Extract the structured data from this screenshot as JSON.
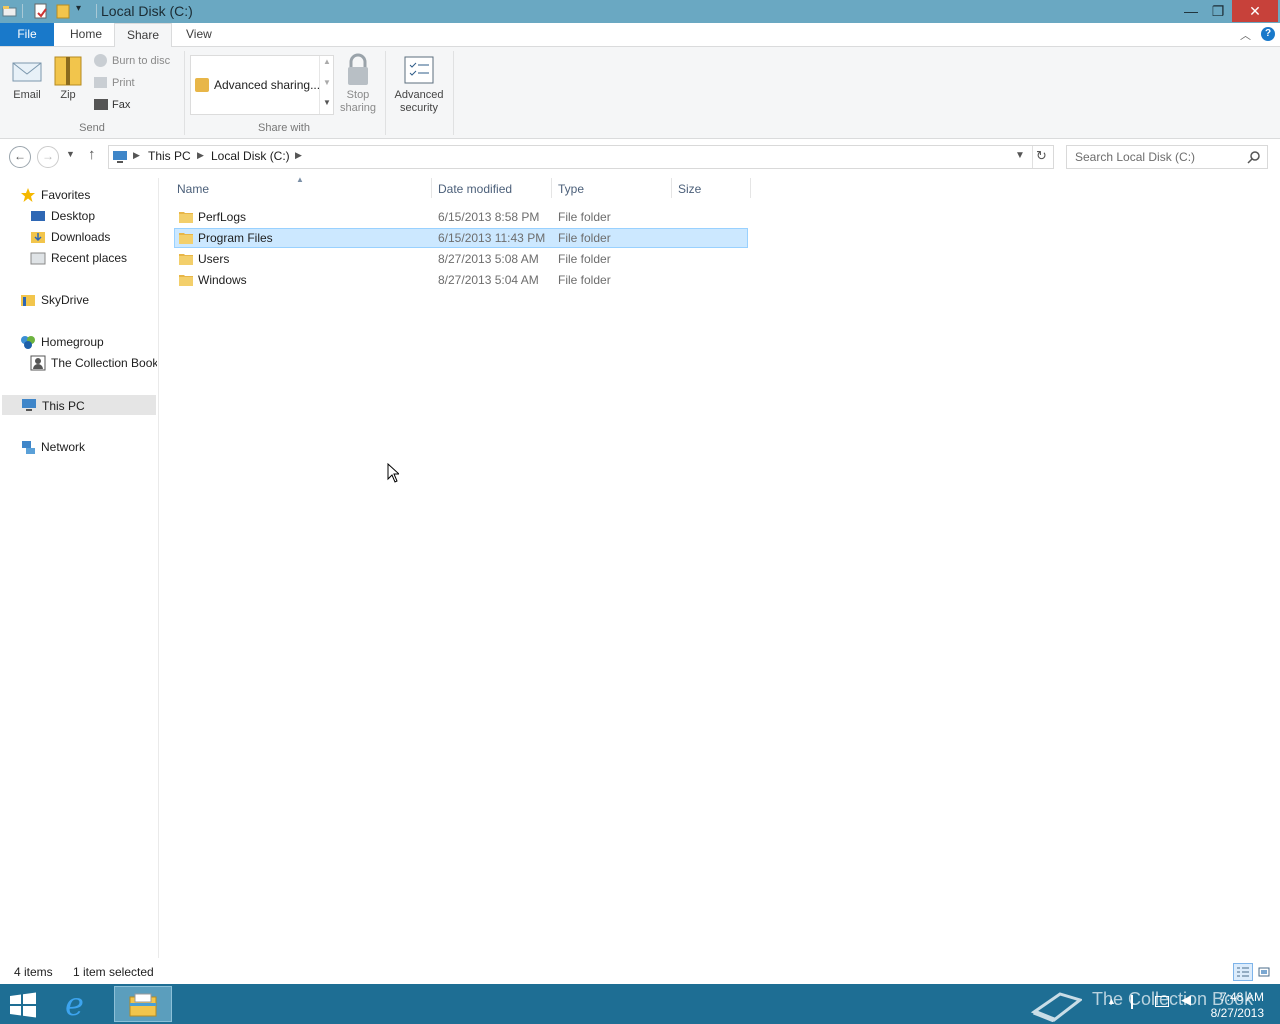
{
  "window": {
    "title": "Local Disk (C:)"
  },
  "ribbon_tabs": [
    "File",
    "Home",
    "Share",
    "View"
  ],
  "ribbon": {
    "send": {
      "email": "Email",
      "zip": "Zip",
      "burn": "Burn to disc",
      "print": "Print",
      "fax": "Fax",
      "group": "Send"
    },
    "share_with": {
      "item": "Advanced sharing...",
      "group": "Share with"
    },
    "stop_sharing": [
      "Stop",
      "sharing"
    ],
    "advanced_security": [
      "Advanced",
      "security"
    ]
  },
  "address": {
    "crumbs": [
      "This PC",
      "Local Disk (C:)"
    ],
    "search_placeholder": "Search Local Disk (C:)"
  },
  "nav": {
    "favorites": "Favorites",
    "desktop": "Desktop",
    "downloads": "Downloads",
    "recent": "Recent places",
    "skydrive": "SkyDrive",
    "homegroup": "Homegroup",
    "collection": "The Collection Book",
    "thispc": "This PC",
    "network": "Network"
  },
  "columns": [
    "Name",
    "Date modified",
    "Type",
    "Size"
  ],
  "files": [
    {
      "name": "PerfLogs",
      "date": "6/15/2013 8:58 PM",
      "type": "File folder"
    },
    {
      "name": "Program Files",
      "date": "6/15/2013 11:43 PM",
      "type": "File folder"
    },
    {
      "name": "Users",
      "date": "8/27/2013 5:08 AM",
      "type": "File folder"
    },
    {
      "name": "Windows",
      "date": "8/27/2013 5:04 AM",
      "type": "File folder"
    }
  ],
  "status": {
    "count": "4 items",
    "selected": "1 item selected"
  },
  "taskbar": {
    "time": "7:48 AM",
    "date": "8/27/2013",
    "watermark": "The Collection Book"
  }
}
